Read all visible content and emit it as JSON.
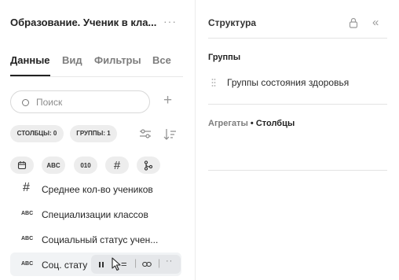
{
  "left_panel": {
    "title": "Образование. Ученик в кла...",
    "more": "···",
    "tabs": [
      {
        "label": "Данные",
        "active": true
      },
      {
        "label": "Вид",
        "active": false
      },
      {
        "label": "Фильтры",
        "active": false
      },
      {
        "label": "Все",
        "active": false
      }
    ],
    "search": {
      "placeholder": "Поиск"
    },
    "chips": {
      "columns": "СТОЛБЦЫ: 0",
      "groups": "ГРУППЫ: 1"
    },
    "field_filters": [
      {
        "icon": "calendar-icon"
      },
      {
        "icon": "text-type-icon",
        "label": "ABC"
      },
      {
        "icon": "numeric-type-icon",
        "label": "010"
      },
      {
        "icon": "hash-icon",
        "label": "#"
      },
      {
        "icon": "hierarchy-icon"
      }
    ],
    "fields": [
      {
        "type": "#",
        "label": "Среднее кол-во учеников"
      },
      {
        "type": "ABC",
        "label": "Специализации классов"
      },
      {
        "type": "ABC",
        "label": "Социальный статус учен..."
      },
      {
        "type": "ABC",
        "label": "Соц. стату"
      }
    ],
    "field_toolbar": {
      "sep": "|",
      "eq": "="
    }
  },
  "right_panel": {
    "title": "Структура",
    "groups_heading": "Группы",
    "group_item": "Группы состояния здоровья",
    "aggregates_heading": "Агрегаты",
    "bullet": "•",
    "columns_heading": "Столбцы"
  }
}
